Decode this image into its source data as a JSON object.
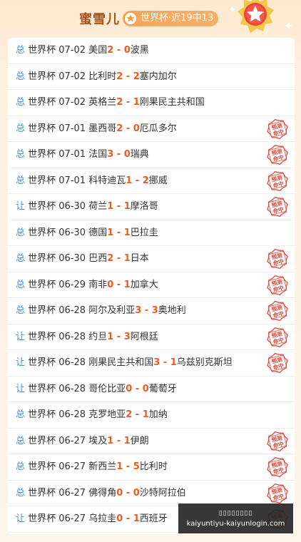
{
  "header": {
    "title": "蜜雪儿",
    "badge": "世界杯·近19中13"
  },
  "stamp_label": "预测命中",
  "colors": {
    "type_blue": "#4a90d9",
    "score_orange": "#ee5a1f",
    "stamp_red": "#e04a3f"
  },
  "matches": [
    {
      "type": "总",
      "league": "世界杯",
      "date": "07-02",
      "home": "美国",
      "home_score": "2",
      "away_score": "0",
      "away": "波黑",
      "hit": false
    },
    {
      "type": "总",
      "league": "世界杯",
      "date": "07-02",
      "home": "比利时",
      "home_score": "2",
      "away_score": "2",
      "away": "塞内加尔",
      "hit": false
    },
    {
      "type": "总",
      "league": "世界杯",
      "date": "07-02",
      "home": "英格兰",
      "home_score": "2",
      "away_score": "1",
      "away": "刚果民主共和国",
      "hit": false
    },
    {
      "type": "总",
      "league": "世界杯",
      "date": "07-01",
      "home": "墨西哥",
      "home_score": "2",
      "away_score": "0",
      "away": "厄瓜多尔",
      "hit": true
    },
    {
      "type": "总",
      "league": "世界杯",
      "date": "07-01",
      "home": "法国",
      "home_score": "3",
      "away_score": "0",
      "away": "瑞典",
      "hit": true
    },
    {
      "type": "总",
      "league": "世界杯",
      "date": "07-01",
      "home": "科特迪瓦",
      "home_score": "1",
      "away_score": "2",
      "away": "挪威",
      "hit": true
    },
    {
      "type": "让",
      "league": "世界杯",
      "date": "06-30",
      "home": "荷兰",
      "home_score": "1",
      "away_score": "1",
      "away": "摩洛哥",
      "hit": true
    },
    {
      "type": "总",
      "league": "世界杯",
      "date": "06-30",
      "home": "德国",
      "home_score": "1",
      "away_score": "1",
      "away": "巴拉圭",
      "hit": false
    },
    {
      "type": "总",
      "league": "世界杯",
      "date": "06-30",
      "home": "巴西",
      "home_score": "2",
      "away_score": "1",
      "away": "日本",
      "hit": true
    },
    {
      "type": "总",
      "league": "世界杯",
      "date": "06-29",
      "home": "南非",
      "home_score": "0",
      "away_score": "1",
      "away": "加拿大",
      "hit": true
    },
    {
      "type": "总",
      "league": "世界杯",
      "date": "06-28",
      "home": "阿尔及利亚",
      "home_score": "3",
      "away_score": "3",
      "away": "奥地利",
      "hit": true
    },
    {
      "type": "让",
      "league": "世界杯",
      "date": "06-28",
      "home": "约旦",
      "home_score": "1",
      "away_score": "3",
      "away": "阿根廷",
      "hit": true
    },
    {
      "type": "让",
      "league": "世界杯",
      "date": "06-28",
      "home": "刚果民主共和国",
      "home_score": "3",
      "away_score": "1",
      "away": "乌兹别克斯坦",
      "hit": true
    },
    {
      "type": "让",
      "league": "世界杯",
      "date": "06-28",
      "home": "哥伦比亚",
      "home_score": "0",
      "away_score": "0",
      "away": "葡萄牙",
      "hit": false
    },
    {
      "type": "总",
      "league": "世界杯",
      "date": "06-28",
      "home": "克罗地亚",
      "home_score": "2",
      "away_score": "1",
      "away": "加纳",
      "hit": false
    },
    {
      "type": "总",
      "league": "世界杯",
      "date": "06-27",
      "home": "埃及",
      "home_score": "1",
      "away_score": "1",
      "away": "伊朗",
      "hit": true
    },
    {
      "type": "总",
      "league": "世界杯",
      "date": "06-27",
      "home": "新西兰",
      "home_score": "1",
      "away_score": "5",
      "away": "比利时",
      "hit": true
    },
    {
      "type": "总",
      "league": "世界杯",
      "date": "06-27",
      "home": "佛得角",
      "home_score": "0",
      "away_score": "0",
      "away": "沙特阿拉伯",
      "hit": true
    },
    {
      "type": "让",
      "league": "世界杯",
      "date": "06-27",
      "home": "乌拉圭",
      "home_score": "0",
      "away_score": "1",
      "away": "西班牙",
      "hit": true
    }
  ],
  "watermark": {
    "line1": "▯▯▯▯▯▯▯▯",
    "line2": "kaiyuntiyu-kaiyunlogin.com"
  }
}
